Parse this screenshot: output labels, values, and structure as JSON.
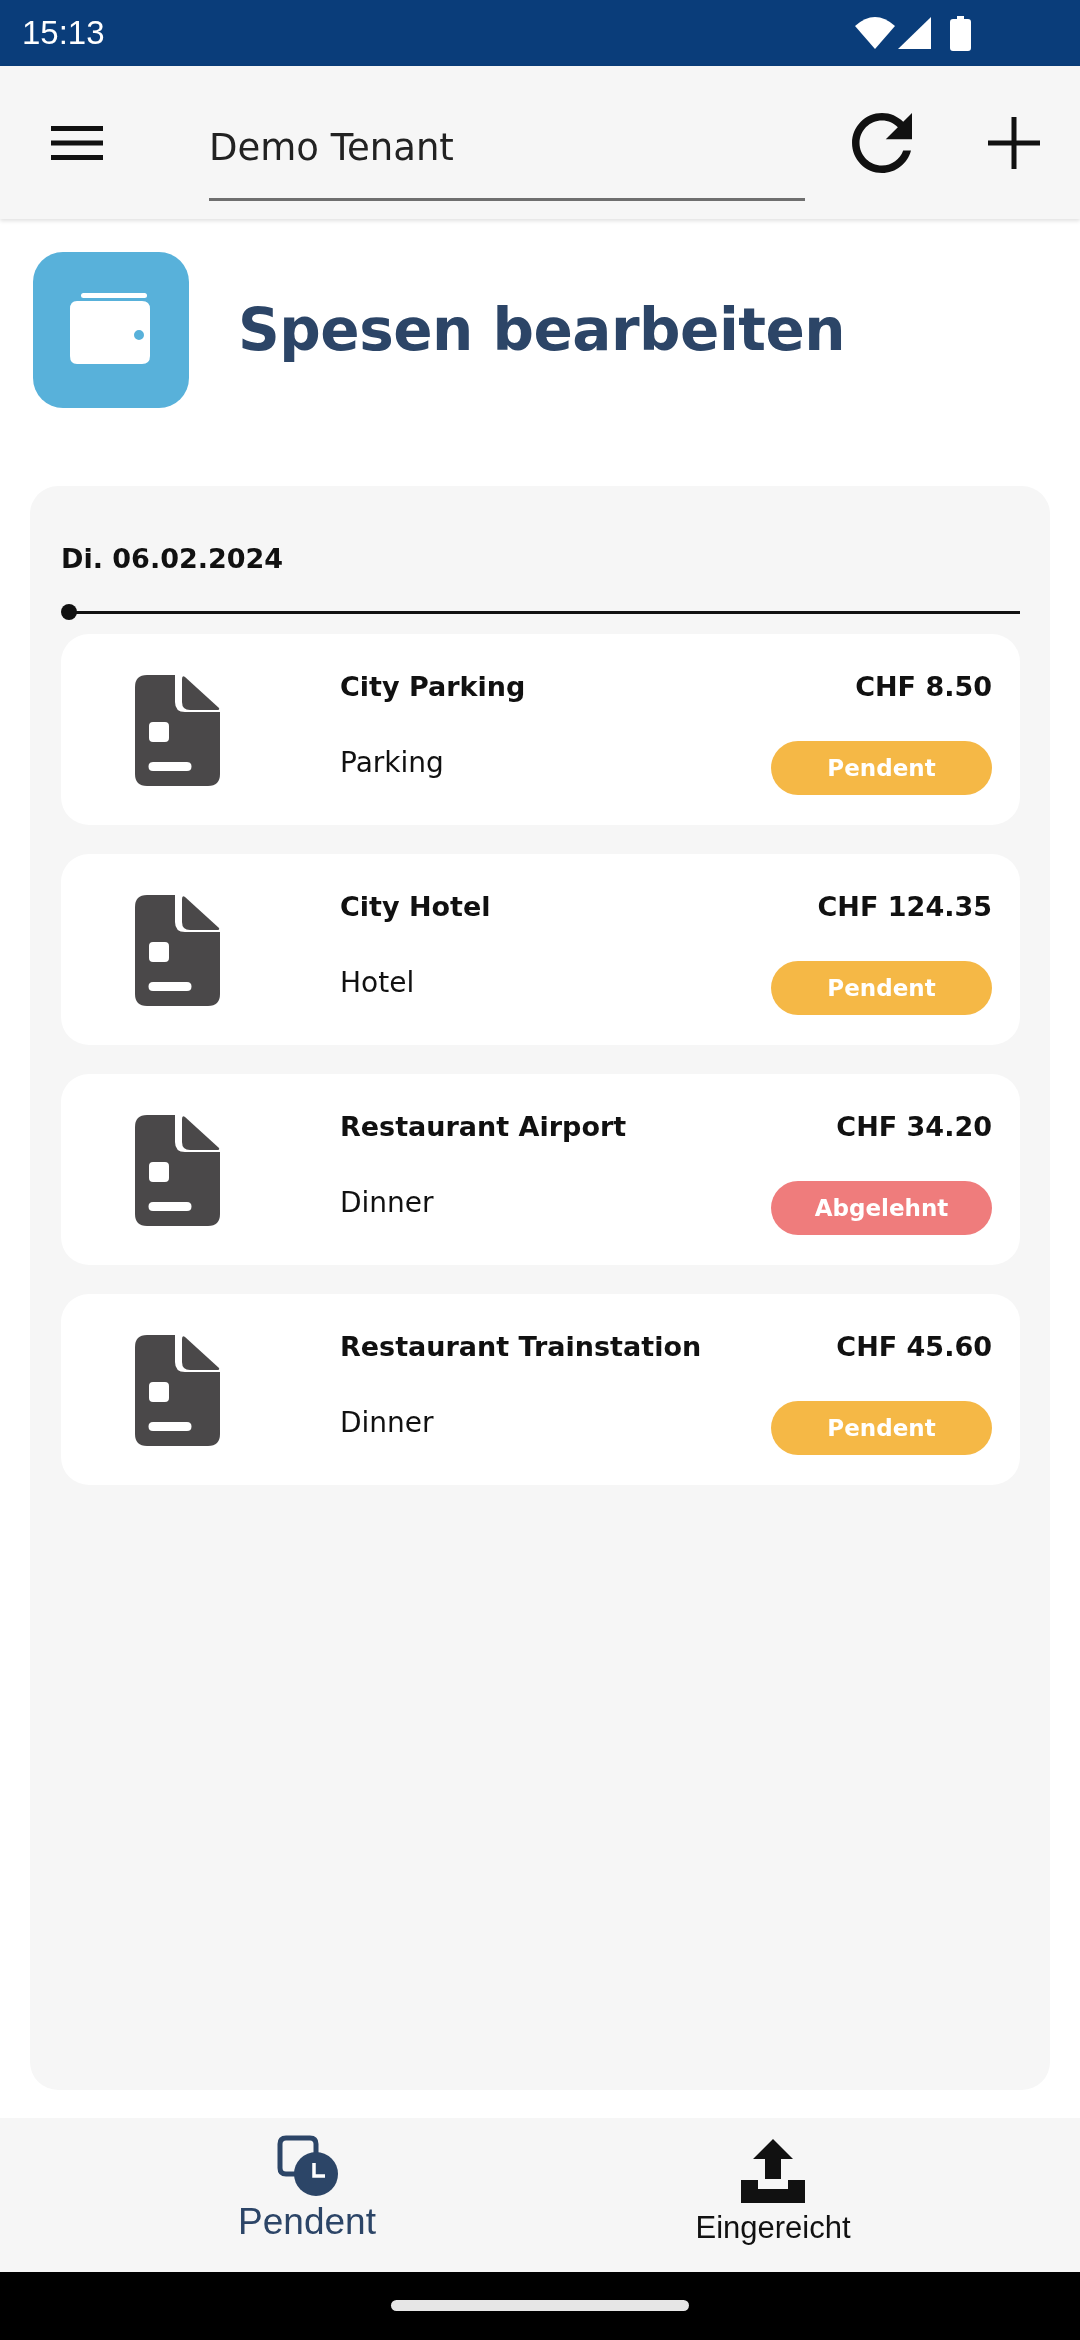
{
  "status_bar": {
    "time": "15:13"
  },
  "app_bar": {
    "tenant_field": {
      "value": "Demo Tenant"
    }
  },
  "header": {
    "title": "Spesen bearbeiten"
  },
  "expense_groups": [
    {
      "date": "Di. 06.02.2024",
      "expenses": [
        {
          "title": "City Parking",
          "amount": "CHF 8.50",
          "category": "Parking",
          "status": {
            "label": "Pendent",
            "color": "#f5b846"
          }
        },
        {
          "title": "City Hotel",
          "amount": "CHF 124.35",
          "category": "Hotel",
          "status": {
            "label": "Pendent",
            "color": "#f5b846"
          }
        },
        {
          "title": "Restaurant Airport",
          "amount": "CHF 34.20",
          "category": "Dinner",
          "status": {
            "label": "Abgelehnt",
            "color": "#ef7c7c"
          }
        },
        {
          "title": "Restaurant Trainstation",
          "amount": "CHF 45.60",
          "category": "Dinner",
          "status": {
            "label": "Pendent",
            "color": "#f5b846"
          }
        }
      ]
    }
  ],
  "bottom_nav": [
    {
      "label": "Pendent",
      "kind": "pending",
      "selected": true
    },
    {
      "label": "Eingereicht",
      "kind": "submitted",
      "selected": false
    }
  ]
}
